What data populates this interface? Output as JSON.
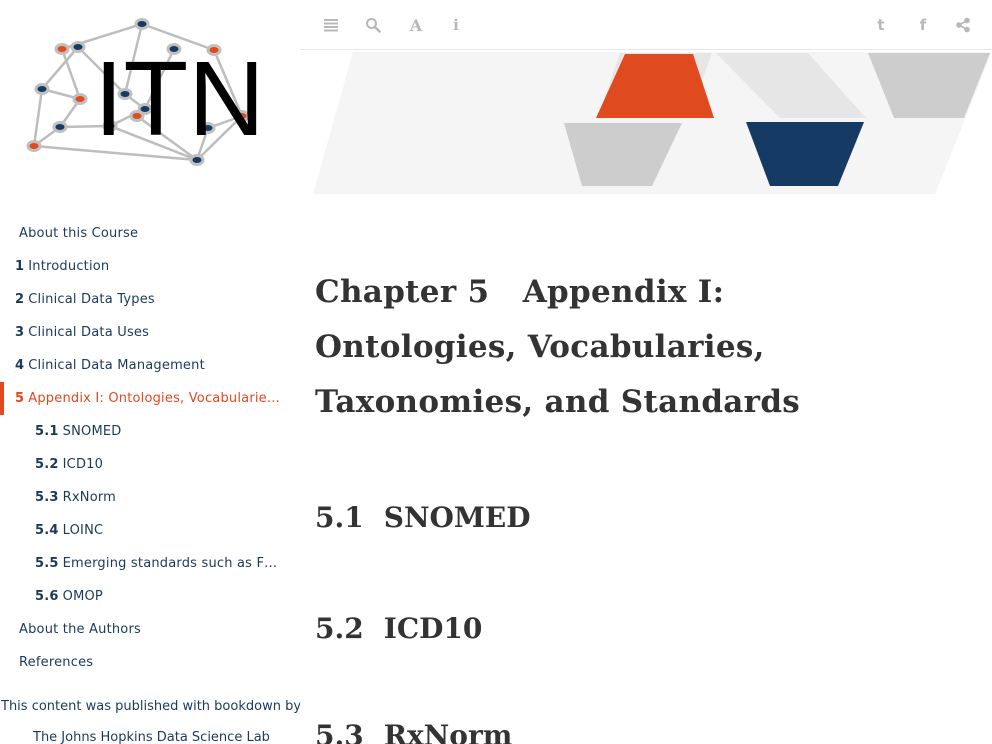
{
  "logo": {
    "text": "ITN"
  },
  "toolbar": {
    "left_icons": [
      "toc-toggle-icon",
      "search-icon",
      "font-settings-icon",
      "info-icon"
    ],
    "right_icons": [
      "twitter-icon",
      "facebook-icon",
      "share-icon"
    ],
    "font_glyph": "A",
    "info_glyph": "i",
    "twitter_glyph": "t",
    "facebook_glyph": "f"
  },
  "colors": {
    "accent": "#e04a1f",
    "navy": "#153a63",
    "text": "#1a3a5c"
  },
  "toc": {
    "items": [
      {
        "num": "",
        "label": "About this Course"
      },
      {
        "num": "1",
        "label": "Introduction"
      },
      {
        "num": "2",
        "label": "Clinical Data Types"
      },
      {
        "num": "3",
        "label": "Clinical Data Uses"
      },
      {
        "num": "4",
        "label": "Clinical Data Management"
      },
      {
        "num": "5",
        "label": "Appendix I: Ontologies, Vocabularies, Taxonomies, and Standards"
      },
      {
        "num": "5.1",
        "label": "SNOMED"
      },
      {
        "num": "5.2",
        "label": "ICD10"
      },
      {
        "num": "5.3",
        "label": "RxNorm"
      },
      {
        "num": "5.4",
        "label": "LOINC"
      },
      {
        "num": "5.5",
        "label": "Emerging standards such as FHIR"
      },
      {
        "num": "5.6",
        "label": "OMOP"
      },
      {
        "num": "",
        "label": "About the Authors"
      },
      {
        "num": "",
        "label": "References"
      }
    ],
    "published_text": "This content was published with bookdown by:",
    "publisher": "The Johns Hopkins Data Science Lab"
  },
  "content": {
    "chapter_prefix": "Chapter 5",
    "chapter_title": "Appendix I: Ontologies, Vocabularies, Taxonomies, and Standards",
    "sections": [
      {
        "num": "5.1",
        "title": "SNOMED"
      },
      {
        "num": "5.2",
        "title": "ICD10"
      },
      {
        "num": "5.3",
        "title": "RxNorm"
      }
    ]
  }
}
